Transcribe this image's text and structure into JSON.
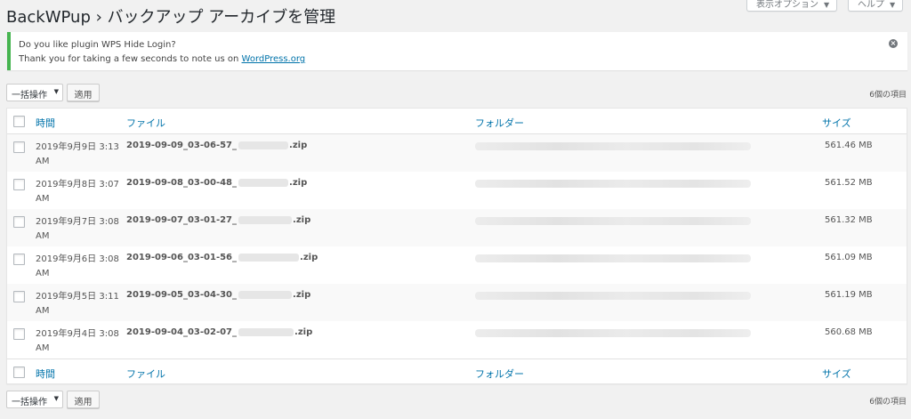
{
  "header": {
    "title": "BackWPup › バックアップ アーカイブを管理",
    "screen_options_label": "表示オプション",
    "help_label": "ヘルプ"
  },
  "notice": {
    "line1": "Do you like plugin WPS Hide Login?",
    "line2_prefix": "Thank you for taking a few seconds to note us on ",
    "link_text": "WordPress.org",
    "accent_color": "#46b450"
  },
  "top_nav": {
    "bulk_actions_label": "一括操作",
    "apply_label": "適用",
    "item_count": "6個の項目"
  },
  "bottom_nav": {
    "bulk_actions_label": "一括操作",
    "apply_label": "適用",
    "item_count": "6個の項目"
  },
  "table": {
    "columns": {
      "time": "時間",
      "file": "ファイル",
      "folder": "フォルダー",
      "size": "サイズ"
    },
    "rows": [
      {
        "time": "2019年9月9日 3:13 AM",
        "file_prefix": "2019-09-09_03-06-57_",
        "file_suffix": ".zip",
        "size": "561.46 MB"
      },
      {
        "time": "2019年9月8日 3:07 AM",
        "file_prefix": "2019-09-08_03-00-48_",
        "file_suffix": ".zip",
        "size": "561.52 MB"
      },
      {
        "time": "2019年9月7日 3:08 AM",
        "file_prefix": "2019-09-07_03-01-27_",
        "file_suffix": ".zip",
        "size": "561.32 MB"
      },
      {
        "time": "2019年9月6日 3:08 AM",
        "file_prefix": "2019-09-06_03-01-56_",
        "file_suffix": ".zip",
        "size": "561.09 MB"
      },
      {
        "time": "2019年9月5日 3:11 AM",
        "file_prefix": "2019-09-05_03-04-30_",
        "file_suffix": ".zip",
        "size": "561.19 MB"
      },
      {
        "time": "2019年9月4日 3:08 AM",
        "file_prefix": "2019-09-04_03-02-07_",
        "file_suffix": ".zip",
        "size": "560.68 MB"
      }
    ]
  },
  "colors": {
    "link": "#0073aa",
    "background": "#f1f1f1"
  }
}
